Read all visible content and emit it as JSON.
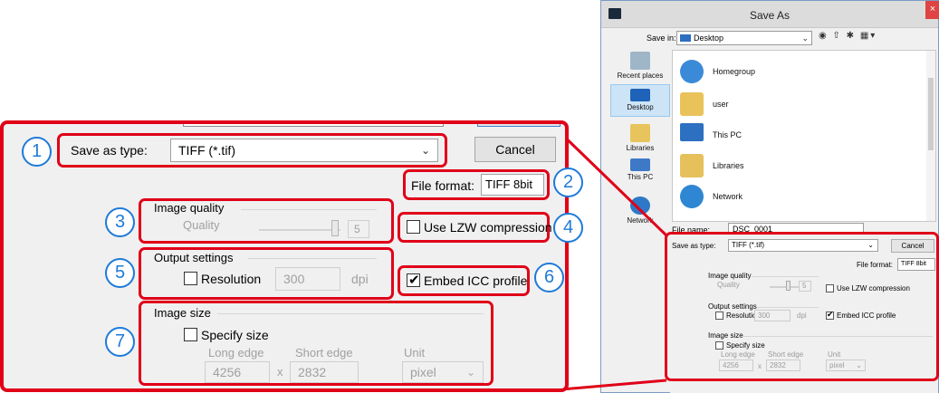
{
  "small_dialog": {
    "title": "Save As",
    "close_glyph": "×",
    "save_in_label": "Save in:",
    "save_in_value": "Desktop",
    "tool_glyphs": "◉ ⇧ ✱ ▦▾",
    "places": [
      {
        "label": "Recent places",
        "icon": "recent-places-icon"
      },
      {
        "label": "Desktop",
        "icon": "desktop-icon"
      },
      {
        "label": "Libraries",
        "icon": "libraries-icon"
      },
      {
        "label": "This PC",
        "icon": "this-pc-icon"
      },
      {
        "label": "Network",
        "icon": "network-icon"
      }
    ],
    "files": [
      {
        "label": "Homegroup",
        "icon": "homegroup-icon"
      },
      {
        "label": "user",
        "icon": "user-folder-icon"
      },
      {
        "label": "This PC",
        "icon": "this-pc-icon"
      },
      {
        "label": "Libraries",
        "icon": "libraries-folder-icon"
      },
      {
        "label": "Network",
        "icon": "network-icon"
      }
    ],
    "file_name_label": "File name:",
    "file_name_value": "DSC_0001",
    "save_as_type_label": "Save as type:",
    "save_as_type_value": "TIFF (*.tif)",
    "cancel_label": "Cancel",
    "file_format_label": "File format:",
    "file_format_value": "TIFF 8bit",
    "image_quality_label": "Image quality",
    "quality_label": "Quality",
    "quality_value": "5",
    "lzw_label": "Use LZW compression",
    "output_settings_label": "Output settings",
    "resolution_label": "Resolution",
    "resolution_value": "300",
    "dpi_label": "dpi",
    "embed_icc_label": "Embed ICC profile",
    "image_size_label": "Image size",
    "specify_size_label": "Specify size",
    "long_edge_label": "Long edge",
    "short_edge_label": "Short edge",
    "unit_label": "Unit",
    "long_edge_value": "4256",
    "times": "x",
    "short_edge_value": "2832",
    "unit_value": "pixel"
  },
  "panel": {
    "save_as_type_label": "Save as type:",
    "save_as_type_value": "TIFF (*.tif)",
    "cancel_label": "Cancel",
    "file_format_label": "File format:",
    "file_format_value": "TIFF 8bit",
    "image_quality_label": "Image quality",
    "quality_label": "Quality",
    "quality_value": "5",
    "lzw_label": "Use LZW compression",
    "output_settings_label": "Output settings",
    "resolution_label": "Resolution",
    "resolution_value": "300",
    "dpi_label": "dpi",
    "embed_icc_label": "Embed ICC profile",
    "image_size_label": "Image size",
    "specify_size_label": "Specify size",
    "long_edge_label": "Long edge",
    "short_edge_label": "Short edge",
    "unit_label": "Unit",
    "long_edge_value": "4256",
    "times": "x",
    "short_edge_value": "2832",
    "unit_value": "pixel",
    "chevron_glyph": "⌄"
  },
  "callouts": [
    "1",
    "2",
    "3",
    "4",
    "5",
    "6",
    "7"
  ],
  "checkbox_state": {
    "lzw": false,
    "resolution": false,
    "embed_icc": true,
    "specify_size": false
  },
  "colors": {
    "highlight": "#e00018",
    "callout": "#1e7ad8",
    "dialog_bg": "#f0f0f0"
  }
}
